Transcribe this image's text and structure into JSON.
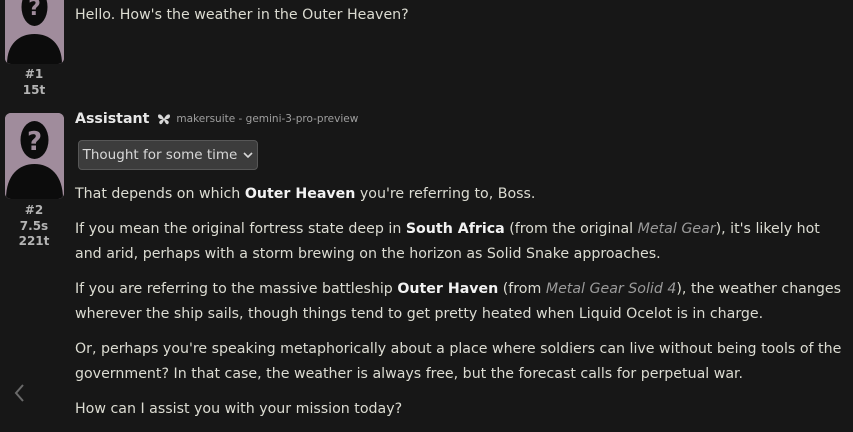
{
  "messages": [
    {
      "role": "user",
      "meta": {
        "index": "#1",
        "tokens": "15t"
      },
      "paragraphs": [
        [
          {
            "t": "Hello. How's the weather in the Outer Heaven?",
            "s": ""
          }
        ]
      ]
    },
    {
      "role": "assistant",
      "name": "Assistant",
      "model": "makersuite - gemini-3-pro-preview",
      "thought_label": "Thought for some time",
      "meta": {
        "index": "#2",
        "time": "7.5s",
        "tokens": "221t"
      },
      "paragraphs": [
        [
          {
            "t": "That depends on which ",
            "s": ""
          },
          {
            "t": "Outer Heaven",
            "s": "b"
          },
          {
            "t": " you're referring to, Boss.",
            "s": ""
          }
        ],
        [
          {
            "t": "If you mean the original fortress state deep in ",
            "s": ""
          },
          {
            "t": "South Africa",
            "s": "b"
          },
          {
            "t": " (from the original ",
            "s": ""
          },
          {
            "t": "Metal Gear",
            "s": "i"
          },
          {
            "t": "), it's likely hot and arid, perhaps with a storm brewing on the horizon as Solid Snake approaches.",
            "s": ""
          }
        ],
        [
          {
            "t": "If you are referring to the massive battleship ",
            "s": ""
          },
          {
            "t": "Outer Haven",
            "s": "b"
          },
          {
            "t": " (from ",
            "s": ""
          },
          {
            "t": "Metal Gear Solid 4",
            "s": "i"
          },
          {
            "t": "), the weather changes wherever the ship sails, though things tend to get pretty heated when Liquid Ocelot is in charge.",
            "s": ""
          }
        ],
        [
          {
            "t": "Or, perhaps you're speaking metaphorically about a place where soldiers can live without being tools of the government? In that case, the weather is always free, but the forecast calls for perpetual war.",
            "s": ""
          }
        ],
        [
          {
            "t": "How can I assist you with your mission today?",
            "s": ""
          }
        ]
      ]
    }
  ],
  "icons": {
    "avatar": "silhouette-question-mark-icon",
    "model": "butterfly-icon",
    "thought_toggle": "chevron-down-icon",
    "nav_prev": "chevron-left-icon"
  },
  "colors": {
    "background": "#171717",
    "avatar_bg": "#a08c9c",
    "bold_text": "#f2f2f2",
    "italic_text": "#9a9a9a"
  }
}
